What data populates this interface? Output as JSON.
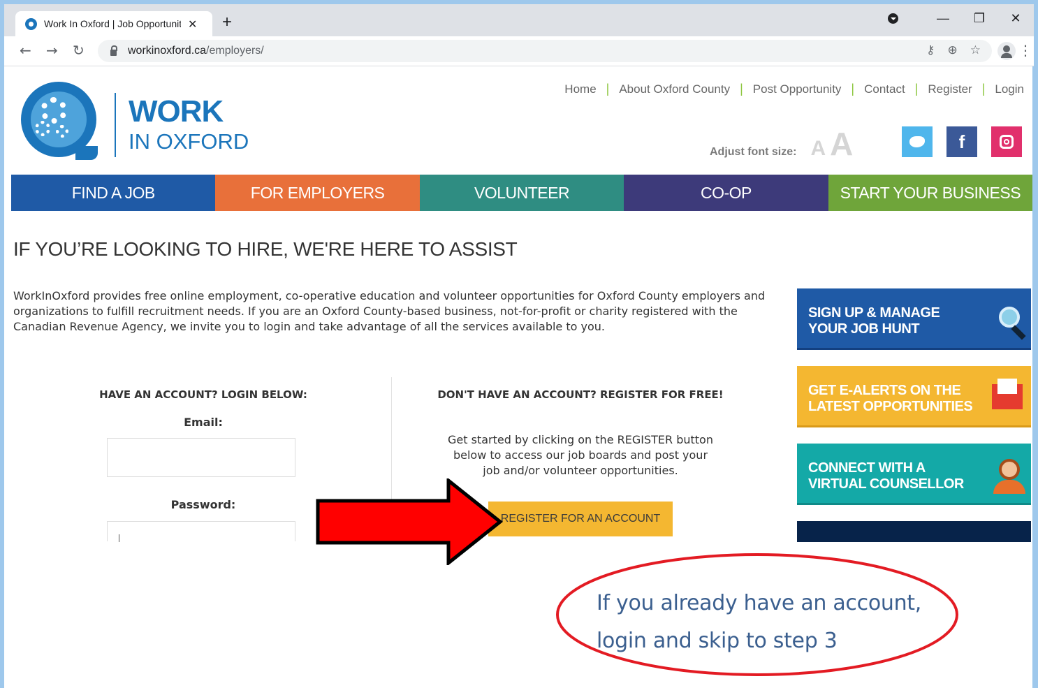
{
  "browser": {
    "tab_title": "Work In Oxford | Job Opportuniti",
    "tab_close": "✕",
    "new_tab": "+",
    "url_domain": "workinoxford.ca",
    "url_path": "/employers/",
    "window_controls": {
      "minimize": "—",
      "restore": "❐",
      "close": "✕"
    }
  },
  "header": {
    "logo_work": "WORK",
    "logo_oxford": "IN OXFORD",
    "top_nav": [
      "Home",
      "About Oxford County",
      "Post Opportunity",
      "Contact",
      "Register",
      "Login"
    ],
    "font_size_label": "Adjust font size:",
    "font_small": "A",
    "font_large": "A",
    "social": {
      "facebook": "f"
    }
  },
  "main_nav": [
    {
      "label": "FIND A JOB",
      "color": "#1f5aa6"
    },
    {
      "label": "FOR EMPLOYERS",
      "color": "#e8703a"
    },
    {
      "label": "VOLUNTEER",
      "color": "#2f8d82"
    },
    {
      "label": "CO-OP",
      "color": "#3d3a7a"
    },
    {
      "label": "START YOUR BUSINESS",
      "color": "#6fa53a"
    }
  ],
  "page": {
    "heading": "IF YOU’RE LOOKING TO HIRE, WE'RE HERE TO ASSIST",
    "intro": "WorkInOxford provides free online employment, co-operative education and volunteer opportunities for Oxford County employers and organizations to fulfill recruitment needs. If you are an Oxford County-based business, not-for-profit or charity registered with the Canadian Revenue Agency, we invite you to login and take advantage of all the services available to you.",
    "login": {
      "heading": "HAVE AN ACCOUNT? LOGIN BELOW:",
      "email_label": "Email:",
      "email_value": "",
      "password_label": "Password:",
      "password_value": ""
    },
    "register": {
      "heading": "DON'T HAVE AN ACCOUNT? REGISTER FOR FREE!",
      "text": "Get started by clicking on the REGISTER button below to access our job boards and post your job and/or volunteer opportunities.",
      "button": "REGISTER FOR AN ACCOUNT"
    }
  },
  "sidebar": {
    "cards": [
      {
        "line1": "SIGN UP & MANAGE",
        "line2": "YOUR JOB HUNT"
      },
      {
        "line1": "GET E-ALERTS ON THE",
        "line2": "LATEST OPPORTUNITIES"
      },
      {
        "line1": "CONNECT WITH A",
        "line2": "VIRTUAL COUNSELLOR"
      }
    ]
  },
  "annotation": {
    "line1": "If you already have an account,",
    "line2": "login and skip to step 3",
    "arrow_color": "#ff0000",
    "ellipse_color": "#e31b23"
  }
}
